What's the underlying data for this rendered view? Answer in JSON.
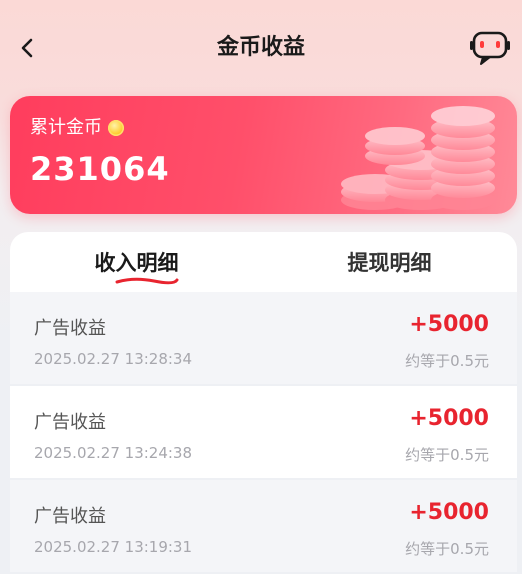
{
  "header": {
    "title": "金币收益",
    "back_icon": "chevron-left-icon",
    "service_icon": "robot-chat-icon"
  },
  "summary": {
    "label": "累计金币",
    "value": "231064",
    "coin_icon": "gold-coin-icon",
    "decoration": "coin-stack-illustration"
  },
  "tabs": [
    {
      "label": "收入明细",
      "active": true
    },
    {
      "label": "提现明细",
      "active": false
    }
  ],
  "records": [
    {
      "title": "广告收益",
      "time": "2025.02.27 13:28:34",
      "amount": "+5000",
      "approx": "约等于0.5元"
    },
    {
      "title": "广告收益",
      "time": "2025.02.27 13:24:38",
      "amount": "+5000",
      "approx": "约等于0.5元"
    },
    {
      "title": "广告收益",
      "time": "2025.02.27 13:19:31",
      "amount": "+5000",
      "approx": "约等于0.5元"
    }
  ],
  "colors": {
    "accent": "#e8242f",
    "card_gradient_start": "#ff3d5d",
    "card_gradient_end": "#ff8a98"
  }
}
